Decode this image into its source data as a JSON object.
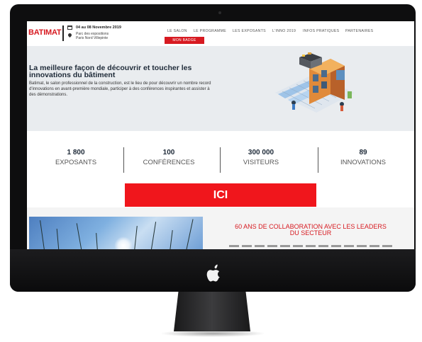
{
  "header": {
    "logo": "BATIMAT",
    "date": "04 au 08 Novembre 2019",
    "venue_line1": "Parc des expositions",
    "venue_line2": "Paris Nord Villepinte",
    "nav": [
      "LE SALON",
      "LE PROGRAMME",
      "LES EXPOSANTS",
      "L'INNO 2019",
      "INFOS PRATIQUES",
      "PARTENAIRES"
    ],
    "badge_label": "MON BADGE"
  },
  "hero": {
    "title": "La meilleure façon de découvrir et toucher les innovations du bâtiment",
    "text": "Batimat, le salon professionnel de la construction, est le lieu de pour découvrir un nombre record d'innovations en avant-première mondiale, participer à des conférences inspirantes et assister à des démonstrations."
  },
  "stats": [
    {
      "value": "1 800",
      "label": "EXPOSANTS"
    },
    {
      "value": "100",
      "label": "CONFÉRENCES"
    },
    {
      "value": "300 000",
      "label": "VISITEURS"
    },
    {
      "value": "89",
      "label": "INNOVATIONS"
    }
  ],
  "cta": {
    "label": "ICI"
  },
  "section": {
    "title": "60 ANS DE COLLABORATION AVEC LES LEADERS DU SECTEUR"
  },
  "colors": {
    "brand_red": "#d71a21",
    "cta_red": "#f0161c",
    "hero_bg": "#e9ecef",
    "device": "#0e0e0f"
  }
}
